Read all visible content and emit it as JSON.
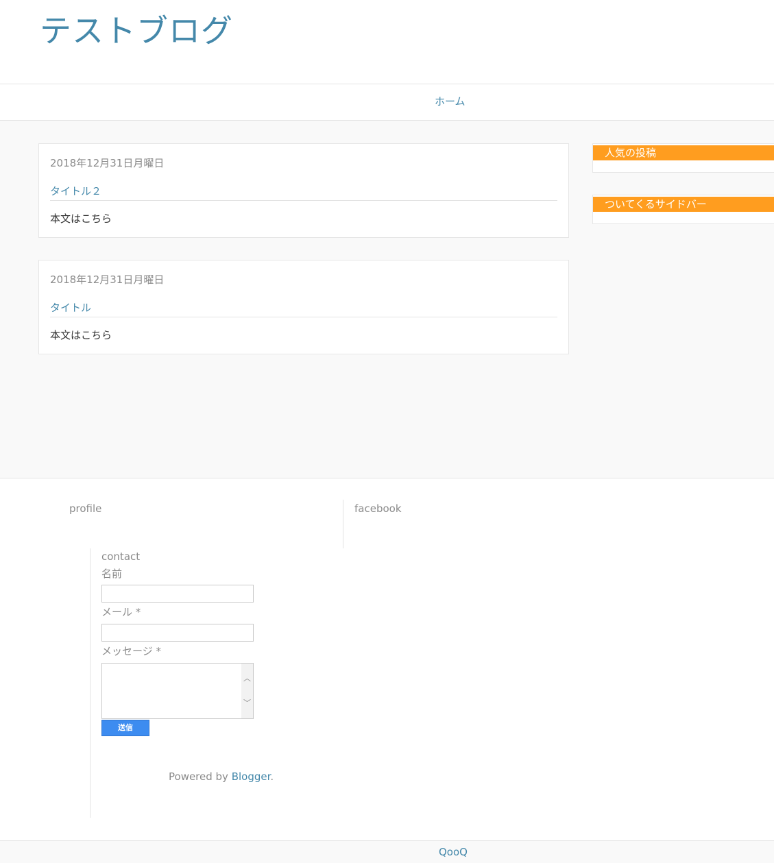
{
  "header": {
    "site_title": "テストブログ"
  },
  "nav": {
    "home_label": "ホーム"
  },
  "posts": [
    {
      "date": "2018年12月31日月曜日",
      "title": "タイトル２",
      "body": "本文はこちら"
    },
    {
      "date": "2018年12月31日月曜日",
      "title": "タイトル",
      "body": "本文はこちら"
    }
  ],
  "sidebar": {
    "widgets": [
      {
        "title": "人気の投稿"
      },
      {
        "title": "ついてくるサイドバー"
      }
    ]
  },
  "footer": {
    "profile_label": "profile",
    "facebook_label": "facebook",
    "contact": {
      "heading": "contact",
      "name_label": "名前",
      "email_label": "メール *",
      "message_label": "メッセージ *",
      "submit_label": "送信"
    },
    "powered_prefix": "Powered by ",
    "powered_link": "Blogger",
    "powered_suffix": "."
  },
  "bottom_bar": {
    "link": "QooQ"
  },
  "colors": {
    "accent": "#4488aa",
    "widget_title_bg": "#ff9d1f",
    "submit_bg": "#3d8cf0"
  }
}
